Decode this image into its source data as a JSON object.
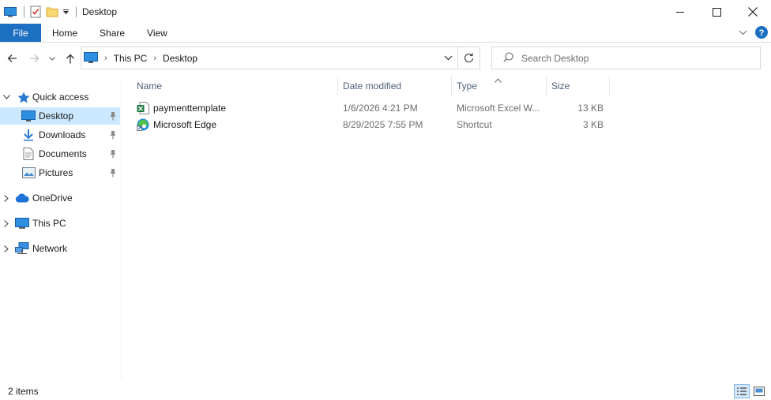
{
  "window": {
    "title": "Desktop",
    "minimize_icon": "minimize-icon",
    "maximize_icon": "maximize-icon",
    "close_icon": "close-icon"
  },
  "ribbon": {
    "tabs": [
      {
        "label": "File"
      },
      {
        "label": "Home"
      },
      {
        "label": "Share"
      },
      {
        "label": "View"
      }
    ]
  },
  "address": {
    "crumbs": [
      "This PC",
      "Desktop"
    ]
  },
  "search": {
    "placeholder": "Search Desktop"
  },
  "sidebar": {
    "items": [
      {
        "label": "Quick access",
        "icon": "star-icon"
      },
      {
        "label": "Desktop",
        "icon": "desktop-icon",
        "pinned": true,
        "selected": true
      },
      {
        "label": "Downloads",
        "icon": "download-icon",
        "pinned": true
      },
      {
        "label": "Documents",
        "icon": "documents-icon",
        "pinned": true
      },
      {
        "label": "Pictures",
        "icon": "pictures-icon",
        "pinned": true
      },
      {
        "label": "OneDrive",
        "icon": "cloud-icon"
      },
      {
        "label": "This PC",
        "icon": "computer-icon"
      },
      {
        "label": "Network",
        "icon": "network-icon"
      }
    ]
  },
  "columns": {
    "name": "Name",
    "date": "Date modified",
    "type": "Type",
    "size": "Size"
  },
  "files": [
    {
      "name": "paymenttemplate",
      "date": "1/6/2026 4:21 PM",
      "type": "Microsoft Excel W...",
      "size": "13 KB",
      "icon": "excel-file-icon"
    },
    {
      "name": "Microsoft Edge",
      "date": "8/29/2025 7:55 PM",
      "type": "Shortcut",
      "size": "3 KB",
      "icon": "edge-shortcut-icon"
    }
  ],
  "status": {
    "item_count": "2 items"
  },
  "colors": {
    "accent": "#1c6fc1",
    "selection": "#cce8ff",
    "header_text": "#4c607a"
  }
}
